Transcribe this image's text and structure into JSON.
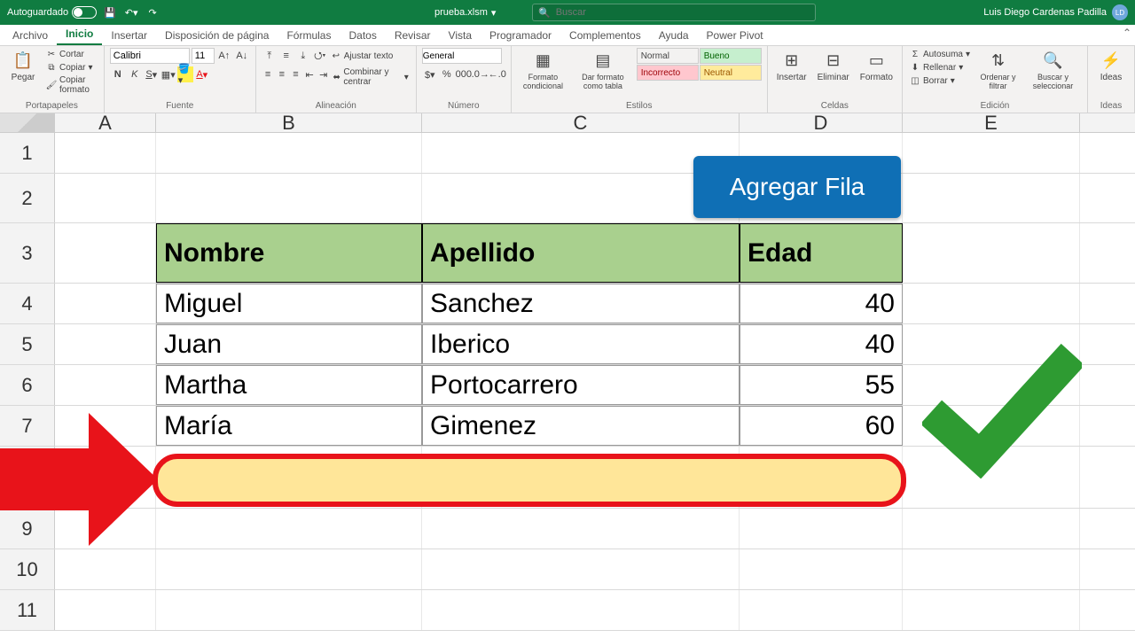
{
  "titlebar": {
    "autosave_label": "Autoguardado",
    "filename": "prueba.xlsm",
    "search_placeholder": "Buscar",
    "user_name": "Luis Diego Cardenas Padilla",
    "user_initials": "LD"
  },
  "tabs": [
    "Archivo",
    "Inicio",
    "Insertar",
    "Disposición de página",
    "Fórmulas",
    "Datos",
    "Revisar",
    "Vista",
    "Programador",
    "Complementos",
    "Ayuda",
    "Power Pivot"
  ],
  "active_tab": 1,
  "ribbon": {
    "clipboard": {
      "paste": "Pegar",
      "cut": "Cortar",
      "copy": "Copiar",
      "format": "Copiar formato",
      "label": "Portapapeles"
    },
    "font": {
      "name": "Calibri",
      "size": "11",
      "label": "Fuente"
    },
    "alignment": {
      "wrap": "Ajustar texto",
      "merge": "Combinar y centrar",
      "label": "Alineación"
    },
    "number": {
      "format": "General",
      "label": "Número"
    },
    "styles": {
      "cond": "Formato condicional",
      "table": "Dar formato como tabla",
      "normal": "Normal",
      "good": "Bueno",
      "bad": "Incorrecto",
      "neutral": "Neutral",
      "label": "Estilos"
    },
    "cells": {
      "insert": "Insertar",
      "delete": "Eliminar",
      "format": "Formato",
      "label": "Celdas"
    },
    "editing": {
      "sum": "Autosuma",
      "fill": "Rellenar",
      "clear": "Borrar",
      "sort": "Ordenar y filtrar",
      "find": "Buscar y seleccionar",
      "label": "Edición"
    },
    "ideas": {
      "label": "Ideas",
      "btn": "Ideas"
    }
  },
  "columns": [
    "A",
    "B",
    "C",
    "D",
    "E"
  ],
  "row_numbers": [
    "1",
    "2",
    "3",
    "4",
    "5",
    "6",
    "7",
    "9",
    "10",
    "11"
  ],
  "table": {
    "headers": {
      "name": "Nombre",
      "surname": "Apellido",
      "age": "Edad"
    },
    "rows": [
      {
        "name": "Miguel",
        "surname": "Sanchez",
        "age": "40"
      },
      {
        "name": "Juan",
        "surname": "Iberico",
        "age": "40"
      },
      {
        "name": "Martha",
        "surname": "Portocarrero",
        "age": "55"
      },
      {
        "name": "María",
        "surname": "Gimenez",
        "age": "60"
      }
    ]
  },
  "macro_button": "Agregar Fila",
  "colors": {
    "accent": "#107c41",
    "button": "#0f6fb5",
    "header_bg": "#a9d08e",
    "highlight": "#ffe699",
    "arrow": "#e8131a",
    "check": "#2e9b32"
  }
}
